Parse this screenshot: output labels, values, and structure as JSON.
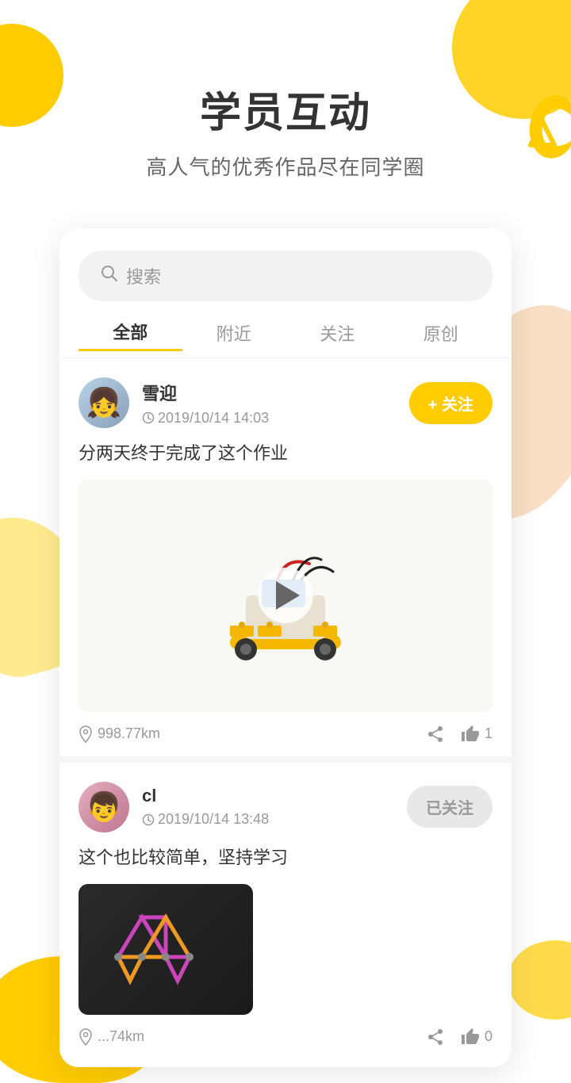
{
  "header": {
    "title": "学员互动",
    "subtitle": "高人气的优秀作品尽在同学圈"
  },
  "search": {
    "placeholder": "搜索"
  },
  "tabs": [
    {
      "label": "全部",
      "active": true
    },
    {
      "label": "附近",
      "active": false
    },
    {
      "label": "关注",
      "active": false
    },
    {
      "label": "原创",
      "active": false
    }
  ],
  "posts": [
    {
      "id": 1,
      "username": "雪迎",
      "time": "2019/10/14 14:03",
      "follow_label": "+ 关注",
      "follow_state": "unfollow",
      "content": "分两天终于完成了这个作业",
      "media_type": "video",
      "location": "998.77km",
      "share_label": "",
      "like_count": "1"
    },
    {
      "id": 2,
      "username": "cl",
      "time": "2019/10/14 13:48",
      "follow_label": "已关注",
      "follow_state": "followed",
      "content": "这个也比较简单，坚持学习",
      "media_type": "image",
      "location": "...74km",
      "share_label": "",
      "like_count": "0"
    }
  ]
}
